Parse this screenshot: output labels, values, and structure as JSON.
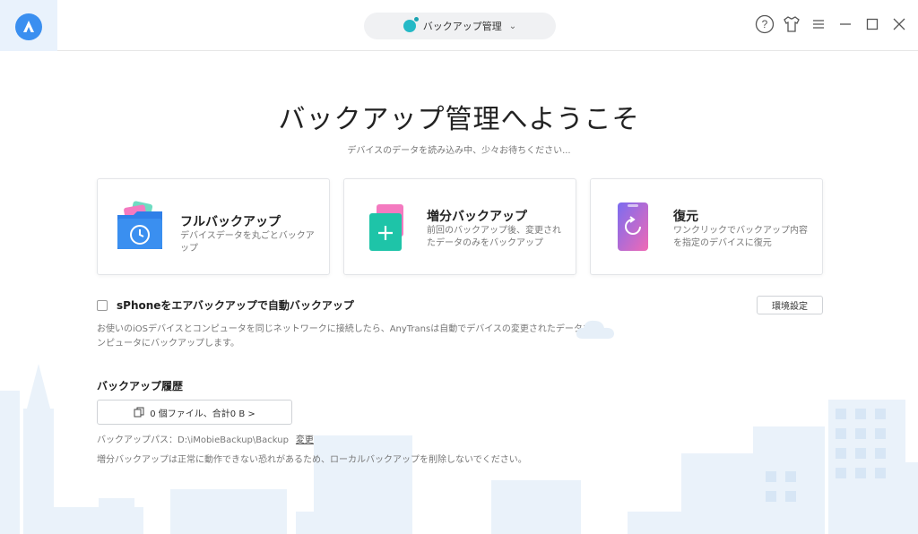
{
  "header": {
    "mode_label": "バックアップ管理",
    "help_icon": "question-circle-icon",
    "skin_icon": "tshirt-icon",
    "menu_icon": "hamburger-icon",
    "minimize_icon": "minimize-icon",
    "maximize_icon": "maximize-icon",
    "close_icon": "close-icon"
  },
  "main": {
    "title": "バックアップ管理へようこそ",
    "subtitle": "デバイスのデータを読み込み中、少々お待ちください..."
  },
  "cards": [
    {
      "title": "フルバックアップ",
      "desc": "デバイスデータを丸ごとバックアップ",
      "icon": "full-backup-icon"
    },
    {
      "title": "増分バックアップ",
      "desc": "前回のバックアップ後、変更されたデータのみをバックアップ",
      "icon": "incremental-backup-icon"
    },
    {
      "title": "復元",
      "desc": "ワンクリックでバックアップ内容を指定のデバイスに復元",
      "icon": "restore-icon"
    }
  ],
  "auto_backup": {
    "label": "sPhoneをエアバックアップで自動バックアップ",
    "checked": false,
    "settings_label": "環境設定",
    "description": "お使いのiOSデバイスとコンピュータを同じネットワークに接続したら、AnyTransは自動でデバイスの変更されたデータをコンピュータにバックアップします。"
  },
  "history": {
    "title": "バックアップ履歴",
    "files_label": "0 個ファイル、合計0 B >",
    "path_label": "バックアップパス：",
    "path_value": "D:\\iMobieBackup\\Backup",
    "change_label": "変更",
    "warning": "増分バックアップは正常に動作できない恐れがあるため、ローカルバックアップを削除しないでください。"
  },
  "colors": {
    "accent": "#3a8ff0",
    "teal": "#25b9c6",
    "skyline": "#e8f1fa"
  }
}
